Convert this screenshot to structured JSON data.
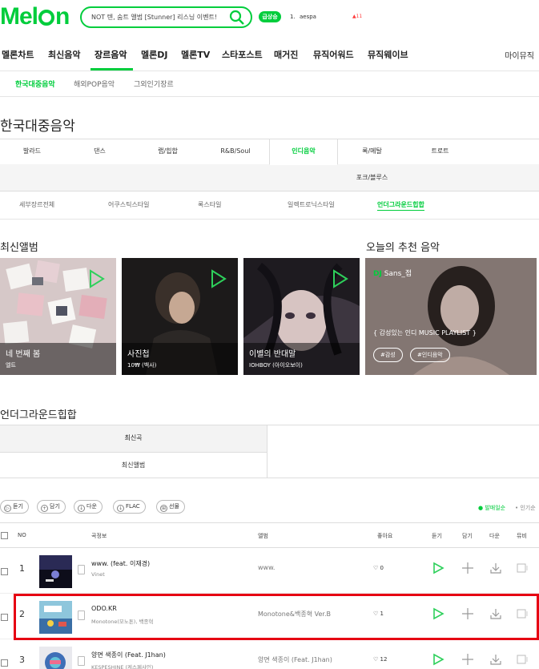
{
  "header": {
    "logo_text_pre": "Mel",
    "logo_text_post": "n",
    "search_text": "NOT 텐, 숨트 앨범 [Stunner] 리스닝 이벤트!",
    "ticket_badge": "급상승",
    "rank_num": "1.",
    "rank_name": "aespa",
    "rank_change": "▲11"
  },
  "gnb": {
    "items": [
      "멜론차트",
      "최신음악",
      "장르음악",
      "멜론DJ",
      "멜론TV",
      "스타포스트",
      "매거진",
      "뮤직어워드",
      "뮤직웨이브"
    ],
    "my_music": "마이뮤직"
  },
  "subnav": [
    "한국대중음악",
    "해외POP음악",
    "그외인기장르"
  ],
  "page_title": "한국대중음악",
  "genres": [
    "발라드",
    "댄스",
    "랩/힙합",
    "R&B/Soul",
    "인디음악",
    "록/메탈",
    "트로트",
    "포크/블루스"
  ],
  "styles": [
    "세부장르전체",
    "어쿠스틱스타일",
    "록스타일",
    "일렉트로닉스타일",
    "언더그라운드힙합"
  ],
  "latest_album_title": "최신앨범",
  "recommend_title": "오늘의 추천 음악",
  "albums": [
    {
      "title": "네 번째 봄",
      "artist": "엘트"
    },
    {
      "title": "사진첩",
      "artist": "10₩ (백사)"
    },
    {
      "title": "이별의 반대말",
      "artist": "IOHBOY (아이오보이)"
    }
  ],
  "recommend": {
    "dj_label": "DJ",
    "dj_name": "Sans_접",
    "playlist_title": "{ 감성있는 인디 MUSIC PLAYLIST }",
    "tags": [
      "#감성",
      "#인디음악"
    ]
  },
  "section2_title": "언더그라운드힙합",
  "tabs": {
    "latest_song": "최신곡",
    "latest_album": "최신앨범"
  },
  "toolbar": {
    "buttons": [
      "듣기",
      "담기",
      "다운",
      "FLAC",
      "선물"
    ],
    "sort_selected": "● 발매일순",
    "sort_other": "• 인기순"
  },
  "table": {
    "headers": {
      "no": "NO",
      "song_info": "곡정보",
      "album": "앨범",
      "like": "좋아요",
      "play": "듣기",
      "add": "담기",
      "download": "다운",
      "mv": "뮤비"
    },
    "rows": [
      {
        "rank": "1",
        "song": "www. (feat. 이재경)",
        "artist": "Vinet",
        "album": "www.",
        "likes": "0"
      },
      {
        "rank": "2",
        "song": "ODO.KR",
        "artist": "Monotone(모노톤), 백종혁",
        "album": "Monotone&백종혁 Ver.B",
        "likes": "1"
      },
      {
        "rank": "3",
        "song": "양면 색종이 (Feat. J1han)",
        "artist": "KESPESHINE (케스페샤인)",
        "album": "양면 색종이 (Feat. J1han)",
        "likes": "12"
      }
    ]
  },
  "colors": {
    "accent": "#00cd3c",
    "highlight": "#e60012"
  }
}
